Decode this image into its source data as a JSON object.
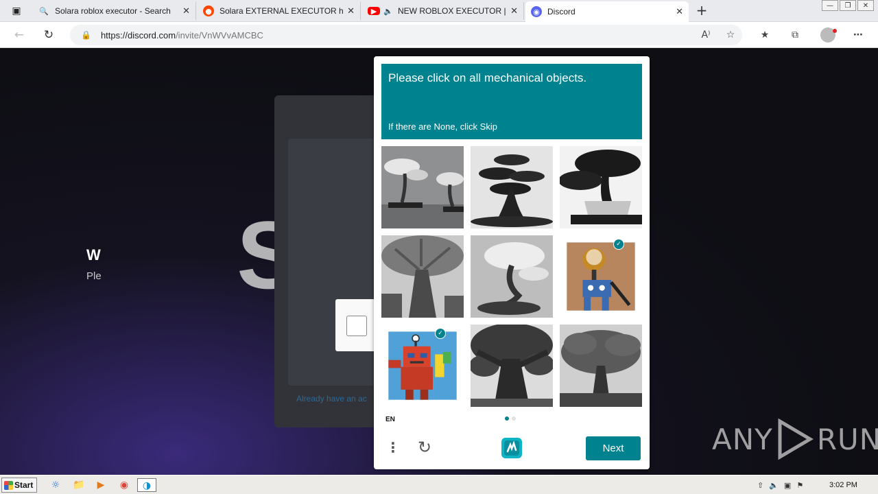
{
  "browser": {
    "tabs": [
      {
        "title": "Solara roblox executor - Search",
        "icon": "search-icon",
        "color": "#1a73e8"
      },
      {
        "title": "Solara EXTERNAL EXECUTOR has",
        "icon": "reddit-icon",
        "color": "#ff4500"
      },
      {
        "title": "NEW ROBLOX EXECUTOR | S",
        "icon": "youtube-icon",
        "color": "#ff0000"
      },
      {
        "title": "Discord",
        "icon": "discord-icon",
        "color": "#5865f2"
      }
    ],
    "url_domain": "https://discord.com",
    "url_path": "/invite/VnWVvAMCBC",
    "read_aloud": "A⁾"
  },
  "discord": {
    "title": "W",
    "subtitle": "Ple",
    "link": "Already have an ac"
  },
  "hcaptcha": {
    "prompt": "Please click on all mechanical objects.",
    "hint": "If there are None, click Skip",
    "language": "EN",
    "next_label": "Next",
    "accent": "#00838f",
    "tiles": [
      {
        "name": "bonsai-pair-tile",
        "selected": false
      },
      {
        "name": "bonsai-tree-tile",
        "selected": false
      },
      {
        "name": "bonsai-pot-tile",
        "selected": false
      },
      {
        "name": "large-tree-tile",
        "selected": false
      },
      {
        "name": "windswept-bonsai-tile",
        "selected": false
      },
      {
        "name": "robot-brown-tile",
        "selected": true
      },
      {
        "name": "robot-red-tile",
        "selected": true
      },
      {
        "name": "oak-tree-tile",
        "selected": false
      },
      {
        "name": "spreading-tree-tile",
        "selected": false
      }
    ]
  },
  "watermark": {
    "left": "ANY",
    "right": "RUN"
  },
  "taskbar": {
    "start_label": "Start",
    "clock": "3:02 PM"
  }
}
